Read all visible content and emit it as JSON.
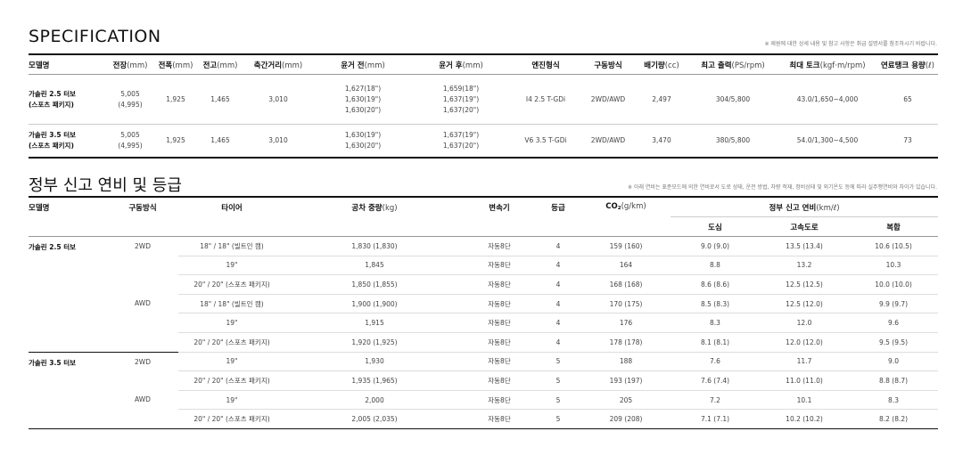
{
  "spec": {
    "title": "SPECIFICATION",
    "note": "※ 제원에 대한 상세 내용 및 참고 사항은 취급 설명서를 참조하시기 바랍니다.",
    "headers": [
      {
        "label": "모델명",
        "unit": ""
      },
      {
        "label": "전장",
        "unit": "(mm)"
      },
      {
        "label": "전폭",
        "unit": "(mm)"
      },
      {
        "label": "전고",
        "unit": "(mm)"
      },
      {
        "label": "축간거리",
        "unit": "(mm)"
      },
      {
        "label": "윤거 전",
        "unit": "(mm)"
      },
      {
        "label": "윤거 후",
        "unit": "(mm)"
      },
      {
        "label": "엔진형식",
        "unit": ""
      },
      {
        "label": "구동방식",
        "unit": ""
      },
      {
        "label": "배기량",
        "unit": "(cc)"
      },
      {
        "label": "최고 출력",
        "unit": "(PS/rpm)"
      },
      {
        "label": "최대 토크",
        "unit": "(kgf·m/rpm)"
      },
      {
        "label": "연료탱크 용량",
        "unit": "(ℓ)"
      }
    ],
    "rows": [
      {
        "model_line1": "가솔린 2.5 터보",
        "model_line2": "(스포츠 패키지)",
        "length_line1": "5,005",
        "length_line2": "(4,995)",
        "width": "1,925",
        "height": "1,465",
        "wheelbase": "3,010",
        "tread_front": [
          "1,627(18\")",
          "1,630(19\")",
          "1,630(20\")"
        ],
        "tread_rear": [
          "1,659(18\")",
          "1,637(19\")",
          "1,637(20\")"
        ],
        "engine": "I4 2.5 T-GDi",
        "drive": "2WD/AWD",
        "displacement": "2,497",
        "power": "304/5,800",
        "torque": "43.0/1,650~4,000",
        "tank": "65"
      },
      {
        "model_line1": "가솔린 3.5 터보",
        "model_line2": "(스포츠 패키지)",
        "length_line1": "5,005",
        "length_line2": "(4,995)",
        "width": "1,925",
        "height": "1,465",
        "wheelbase": "3,010",
        "tread_front": [
          "1,630(19\")",
          "1,630(20\")"
        ],
        "tread_rear": [
          "1,637(19\")",
          "1,637(20\")"
        ],
        "engine": "V6 3.5 T-GDi",
        "drive": "2WD/AWD",
        "displacement": "3,470",
        "power": "380/5,800",
        "torque": "54.0/1,300~4,500",
        "tank": "73"
      }
    ]
  },
  "mileage": {
    "title": "정부 신고 연비 및 등급",
    "note": "※ 아래 연비는 표준모드에 의한 연비로서 도로 상태, 운전 방법, 차량 적재, 정비상태 및 외기온도 등에 따라 실주행연비와 차이가 있습니다.",
    "headers": {
      "model": "모델명",
      "drive": "구동방식",
      "tire": "타이어",
      "weight": "공차 중량",
      "weight_unit": "(kg)",
      "trans": "변속기",
      "grade": "등급",
      "co2": "CO",
      "co2_sub": "2",
      "co2_unit": "(g/km)",
      "eff": "정부 신고 연비",
      "eff_unit": "(km/ℓ)",
      "city": "도심",
      "hwy": "고속도로",
      "comb": "복합"
    },
    "groups": [
      {
        "model": "가솔린 2.5 터보",
        "drives": [
          {
            "drive": "2WD",
            "rows": [
              {
                "tire": "18\" / 18\" (빌트인 캠)",
                "weight": "1,830 (1,830)",
                "trans": "자동8단",
                "grade": "4",
                "co2": "159 (160)",
                "city": "9.0 (9.0)",
                "hwy": "13.5 (13.4)",
                "comb": "10.6 (10.5)"
              },
              {
                "tire": "19\"",
                "weight": "1,845",
                "trans": "자동8단",
                "grade": "4",
                "co2": "164",
                "city": "8.8",
                "hwy": "13.2",
                "comb": "10.3"
              },
              {
                "tire": "20\" / 20\" (스포츠 패키지)",
                "weight": "1,850 (1,855)",
                "trans": "자동8단",
                "grade": "4",
                "co2": "168 (168)",
                "city": "8.6 (8.6)",
                "hwy": "12.5 (12.5)",
                "comb": "10.0 (10.0)"
              }
            ]
          },
          {
            "drive": "AWD",
            "rows": [
              {
                "tire": "18\" / 18\" (빌트인 캠)",
                "weight": "1,900 (1,900)",
                "trans": "자동8단",
                "grade": "4",
                "co2": "170 (175)",
                "city": "8.5 (8.3)",
                "hwy": "12.5 (12.0)",
                "comb": "9.9 (9.7)"
              },
              {
                "tire": "19\"",
                "weight": "1,915",
                "trans": "자동8단",
                "grade": "4",
                "co2": "176",
                "city": "8.3",
                "hwy": "12.0",
                "comb": "9.6"
              },
              {
                "tire": "20\" / 20\" (스포츠 패키지)",
                "weight": "1,920 (1,925)",
                "trans": "자동8단",
                "grade": "4",
                "co2": "178 (178)",
                "city": "8.1 (8.1)",
                "hwy": "12.0 (12.0)",
                "comb": "9.5 (9.5)"
              }
            ]
          }
        ]
      },
      {
        "model": "가솔린 3.5 터보",
        "drives": [
          {
            "drive": "2WD",
            "rows": [
              {
                "tire": "19\"",
                "weight": "1,930",
                "trans": "자동8단",
                "grade": "5",
                "co2": "188",
                "city": "7.6",
                "hwy": "11.7",
                "comb": "9.0"
              },
              {
                "tire": "20\" / 20\" (스포츠 패키지)",
                "weight": "1,935 (1,965)",
                "trans": "자동8단",
                "grade": "5",
                "co2": "193 (197)",
                "city": "7.6 (7.4)",
                "hwy": "11.0 (11.0)",
                "comb": "8.8 (8.7)"
              }
            ]
          },
          {
            "drive": "AWD",
            "rows": [
              {
                "tire": "19\"",
                "weight": "2,000",
                "trans": "자동8단",
                "grade": "5",
                "co2": "205",
                "city": "7.2",
                "hwy": "10.1",
                "comb": "8.3"
              },
              {
                "tire": "20\" / 20\" (스포츠 패키지)",
                "weight": "2,005 (2,035)",
                "trans": "자동8단",
                "grade": "5",
                "co2": "209 (208)",
                "city": "7.1 (7.1)",
                "hwy": "10.2 (10.2)",
                "comb": "8.2 (8.2)"
              }
            ]
          }
        ]
      }
    ]
  }
}
